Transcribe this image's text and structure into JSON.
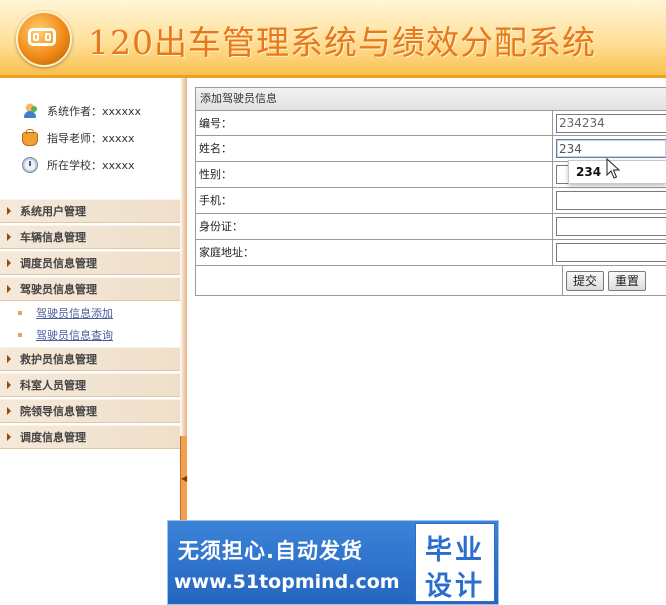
{
  "header": {
    "title": "120出车管理系统与绩效分配系统",
    "logo_icon": "system-logo-icon"
  },
  "sidebar": {
    "info": [
      {
        "icon": "author-icon",
        "label": "系统作者：xxxxxx"
      },
      {
        "icon": "teacher-icon",
        "label": "指导老师：xxxxx"
      },
      {
        "icon": "school-icon",
        "label": "所在学校：xxxxx"
      }
    ],
    "menu": [
      {
        "label": "系统用户管理"
      },
      {
        "label": "车辆信息管理"
      },
      {
        "label": "调度员信息管理"
      },
      {
        "label": "驾驶员信息管理",
        "submenu": [
          "驾驶员信息添加",
          "驾驶员信息查询"
        ]
      },
      {
        "label": "救护员信息管理"
      },
      {
        "label": "科室人员管理"
      },
      {
        "label": "院领导信息管理"
      },
      {
        "label": "调度信息管理"
      }
    ]
  },
  "form": {
    "caption": "添加驾驶员信息",
    "fields": [
      {
        "label": "编号：",
        "value": "234234"
      },
      {
        "label": "姓名：",
        "value": "234"
      },
      {
        "label": "性别：",
        "value": ""
      },
      {
        "label": "手机：",
        "value": ""
      },
      {
        "label": "身份证：",
        "value": ""
      },
      {
        "label": "家庭地址：",
        "value": ""
      }
    ],
    "submit_label": "提交",
    "reset_label": "重置",
    "autocomplete_suggestion": "234"
  },
  "banner": {
    "line1": "无须担心.自动发货",
    "line2": "www.51topmind.com",
    "badge_line1": "毕业",
    "badge_line2": "设计"
  },
  "colors": {
    "title": "#e8781c",
    "accent": "#f0a020",
    "banner": "#2f74cc"
  }
}
